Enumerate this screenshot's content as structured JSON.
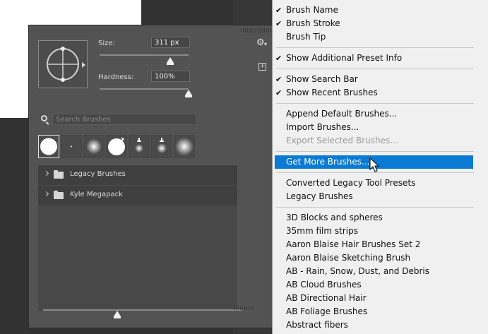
{
  "panel": {
    "size_label": "Size:",
    "size_value": "311 px",
    "hardness_label": "Hardness:",
    "hardness_value": "100%",
    "search_placeholder": "Search Brushes",
    "new_preset_icon": "plus-icon",
    "gear_icon": "gear-icon",
    "folders": [
      {
        "label": "Legacy Brushes"
      },
      {
        "label": "Kyle Megapack"
      }
    ]
  },
  "menu": {
    "items": [
      {
        "label": "Brush Name",
        "checked": true
      },
      {
        "label": "Brush Stroke",
        "checked": true
      },
      {
        "label": "Brush Tip",
        "checked": false
      },
      {
        "label": "Show Additional Preset Info",
        "checked": true
      },
      {
        "label": "Show Search Bar",
        "checked": true
      },
      {
        "label": "Show Recent Brushes",
        "checked": true
      },
      {
        "label": "Append Default Brushes...",
        "checked": false
      },
      {
        "label": "Import Brushes...",
        "checked": false
      },
      {
        "label": "Export Selected Brushes...",
        "checked": false,
        "disabled": true
      },
      {
        "label": "Get More Brushes...",
        "checked": false,
        "highlighted": true
      },
      {
        "label": "Converted Legacy Tool Presets",
        "checked": false
      },
      {
        "label": "Legacy Brushes",
        "checked": false
      },
      {
        "label": "3D Blocks and spheres",
        "checked": false
      },
      {
        "label": "35mm film strips",
        "checked": false
      },
      {
        "label": "Aaron Blaise Hair Brushes Set 2",
        "checked": false
      },
      {
        "label": "Aaron Blaise Sketching Brush",
        "checked": false
      },
      {
        "label": "AB - Rain, Snow, Dust, and Debris",
        "checked": false
      },
      {
        "label": "AB Cloud Brushes",
        "checked": false
      },
      {
        "label": "AB Directional Hair",
        "checked": false
      },
      {
        "label": "AB Foliage Brushes",
        "checked": false
      },
      {
        "label": "Abstract fibers",
        "checked": false
      }
    ],
    "check_glyph": "✔"
  },
  "colors": {
    "highlight": "#0a7ad4",
    "panel": "#535353",
    "menu_bg": "#f0f0f0"
  }
}
